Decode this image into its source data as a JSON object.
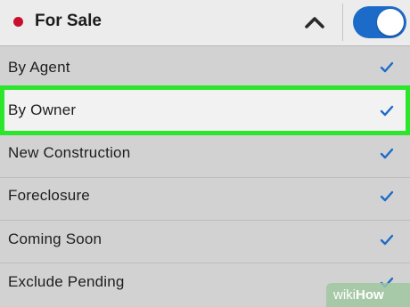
{
  "header": {
    "title": "For Sale",
    "status_dot_color": "#c8102e",
    "collapse_icon": "chevron-up-icon",
    "toggle_on": true,
    "toggle_color": "#1d6bc9"
  },
  "options": [
    {
      "label": "By Agent",
      "checked": true,
      "highlighted": false
    },
    {
      "label": "By Owner",
      "checked": true,
      "highlighted": true
    },
    {
      "label": "New Construction",
      "checked": true,
      "highlighted": false
    },
    {
      "label": "Foreclosure",
      "checked": true,
      "highlighted": false
    },
    {
      "label": "Coming Soon",
      "checked": true,
      "highlighted": false
    },
    {
      "label": "Exclude Pending",
      "checked": true,
      "highlighted": false
    }
  ],
  "check_color": "#1d6bc9",
  "highlight_color": "#2ce62c",
  "watermark": {
    "wiki": "wiki",
    "how": "How"
  }
}
